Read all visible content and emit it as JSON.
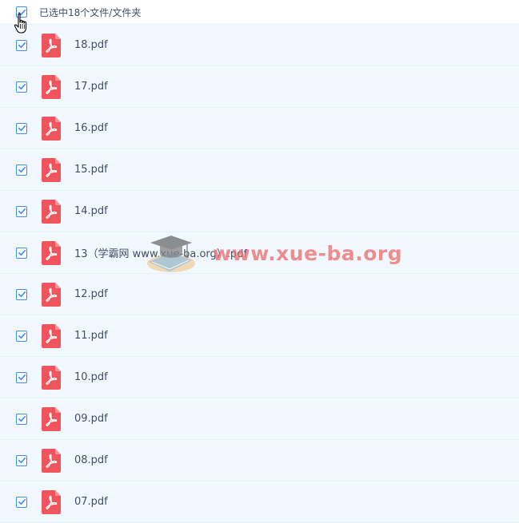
{
  "header": {
    "selected_text": "已选中18个文件/文件夹",
    "checked": true
  },
  "files": [
    {
      "name": "18.pdf",
      "checked": true
    },
    {
      "name": "17.pdf",
      "checked": true
    },
    {
      "name": "16.pdf",
      "checked": true
    },
    {
      "name": "15.pdf",
      "checked": true
    },
    {
      "name": "14.pdf",
      "checked": true
    },
    {
      "name": "13（学霸网 www.xue-ba.org）.pdf",
      "checked": true
    },
    {
      "name": "12.pdf",
      "checked": true
    },
    {
      "name": "11.pdf",
      "checked": true
    },
    {
      "name": "10.pdf",
      "checked": true
    },
    {
      "name": "09.pdf",
      "checked": true
    },
    {
      "name": "08.pdf",
      "checked": true
    },
    {
      "name": "07.pdf",
      "checked": true
    }
  ],
  "watermark": {
    "text": "www.xue-ba.org"
  },
  "colors": {
    "checkbox_accent": "#3b8cff",
    "row_background": "#f2f8ff",
    "pdf_icon": "#f0545c",
    "text": "#424e67"
  },
  "icons": {
    "file": "pdf-file-icon",
    "checkbox": "checkmark-icon",
    "cursor": "hand-pointer-icon"
  }
}
